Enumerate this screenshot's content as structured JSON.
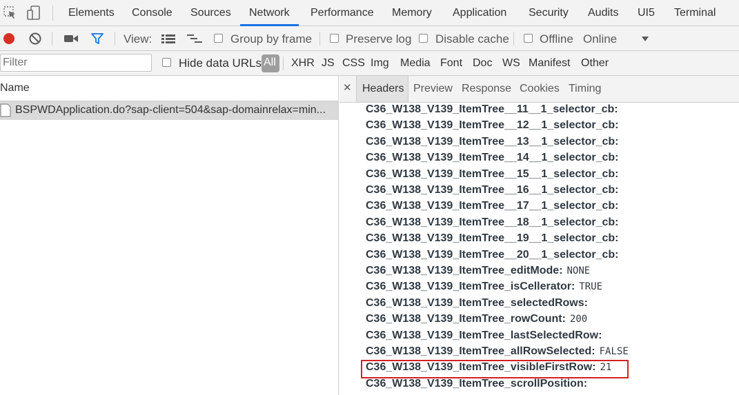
{
  "tabbar": {
    "tabs": [
      {
        "label": "Elements"
      },
      {
        "label": "Console"
      },
      {
        "label": "Sources"
      },
      {
        "label": "Network"
      },
      {
        "label": "Performance"
      },
      {
        "label": "Memory"
      },
      {
        "label": "Application"
      },
      {
        "label": "Security"
      },
      {
        "label": "Audits"
      },
      {
        "label": "UI5"
      },
      {
        "label": "Terminal"
      }
    ],
    "active_tab": "Network"
  },
  "toolbar": {
    "view_label": "View:",
    "group_by_frame": "Group by frame",
    "preserve_log": "Preserve log",
    "disable_cache": "Disable cache",
    "offline": "Offline",
    "throttle": "Online",
    "record_color": "#d93025",
    "filter_color": "#1a73e8"
  },
  "filterbar": {
    "placeholder": "Filter",
    "hide_data_urls": "Hide data URLs",
    "types": [
      "All",
      "XHR",
      "JS",
      "CSS",
      "Img",
      "Media",
      "Font",
      "Doc",
      "WS",
      "Manifest",
      "Other"
    ]
  },
  "requests": {
    "column_name": "Name",
    "items": [
      {
        "name": "BSPWDApplication.do?sap-client=504&sap-domainrelax=min..."
      }
    ]
  },
  "details": {
    "close_glyph": "✕",
    "tabs": [
      "Headers",
      "Preview",
      "Response",
      "Cookies",
      "Timing"
    ],
    "active_tab": "Headers",
    "lines": [
      {
        "key": "C36_W138_V139_ItemTree__11__1_selector_cb:",
        "value": ""
      },
      {
        "key": "C36_W138_V139_ItemTree__12__1_selector_cb:",
        "value": ""
      },
      {
        "key": "C36_W138_V139_ItemTree__13__1_selector_cb:",
        "value": ""
      },
      {
        "key": "C36_W138_V139_ItemTree__14__1_selector_cb:",
        "value": ""
      },
      {
        "key": "C36_W138_V139_ItemTree__15__1_selector_cb:",
        "value": ""
      },
      {
        "key": "C36_W138_V139_ItemTree__16__1_selector_cb:",
        "value": ""
      },
      {
        "key": "C36_W138_V139_ItemTree__17__1_selector_cb:",
        "value": ""
      },
      {
        "key": "C36_W138_V139_ItemTree__18__1_selector_cb:",
        "value": ""
      },
      {
        "key": "C36_W138_V139_ItemTree__19__1_selector_cb:",
        "value": ""
      },
      {
        "key": "C36_W138_V139_ItemTree__20__1_selector_cb:",
        "value": ""
      },
      {
        "key": "C36_W138_V139_ItemTree_editMode:",
        "value": "NONE"
      },
      {
        "key": "C36_W138_V139_ItemTree_isCellerator:",
        "value": "TRUE"
      },
      {
        "key": "C36_W138_V139_ItemTree_selectedRows:",
        "value": ""
      },
      {
        "key": "C36_W138_V139_ItemTree_rowCount:",
        "value": "200"
      },
      {
        "key": "C36_W138_V139_ItemTree_lastSelectedRow:",
        "value": ""
      },
      {
        "key": "C36_W138_V139_ItemTree_allRowSelected:",
        "value": "FALSE"
      },
      {
        "key": "C36_W138_V139_ItemTree_visibleFirstRow:",
        "value": "21"
      },
      {
        "key": "C36_W138_V139_ItemTree_scrollPosition:",
        "value": ""
      }
    ],
    "highlight_color": "#d42020"
  }
}
